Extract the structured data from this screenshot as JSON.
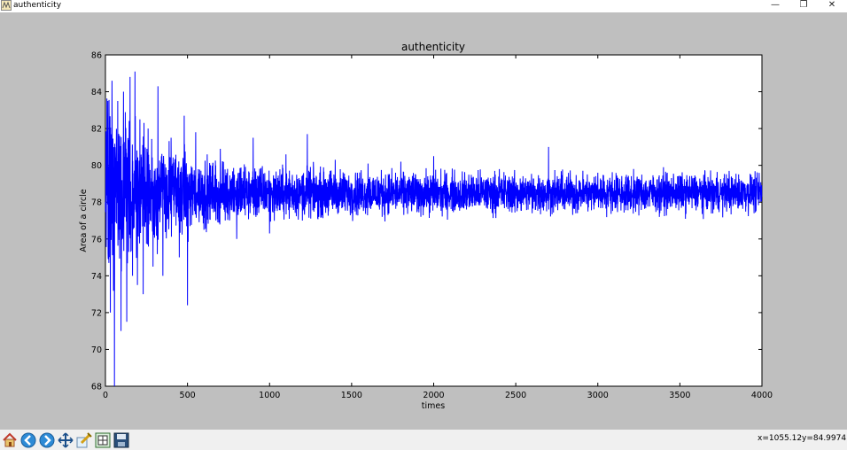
{
  "window": {
    "title": "authenticity",
    "controls": {
      "minimize": "—",
      "restore": "❐",
      "close": "✕"
    }
  },
  "chart_data": {
    "type": "line",
    "title": "authenticity",
    "xlabel": "times",
    "ylabel": "Area of a circle",
    "xlim": [
      0,
      4000
    ],
    "ylim": [
      68,
      86
    ],
    "xticks": [
      0,
      500,
      1000,
      1500,
      2000,
      2500,
      3000,
      3500,
      4000
    ],
    "yticks": [
      68,
      70,
      72,
      74,
      76,
      78,
      80,
      82,
      84,
      86
    ],
    "grid": false,
    "line_color": "#0000ff",
    "series": [
      {
        "n_points": 4000,
        "center": 78.5,
        "x": [
          0,
          15,
          30,
          40,
          55,
          75,
          95,
          110,
          130,
          150,
          165,
          180,
          195,
          210,
          230,
          260,
          290,
          320,
          350,
          400,
          450,
          480,
          500,
          550,
          600,
          700,
          800,
          900,
          1000,
          1100,
          1200,
          1230,
          1300,
          1400,
          1500,
          1600,
          1700,
          1800,
          1900,
          2000,
          2200,
          2400,
          2600,
          2700,
          2800,
          3000,
          3200,
          3400,
          3600,
          3800,
          4000
        ],
        "y": [
          78.0,
          83.5,
          72.0,
          84.6,
          68.0,
          83.5,
          71.0,
          84.0,
          71.5,
          84.8,
          74.0,
          85.1,
          73.5,
          82.5,
          73.0,
          82.0,
          74.5,
          84.3,
          74.0,
          81.5,
          75.0,
          82.7,
          72.4,
          81.8,
          76.5,
          80.9,
          76.0,
          81.5,
          76.3,
          80.6,
          77.0,
          81.7,
          77.2,
          80.3,
          77.4,
          80.1,
          77.3,
          80.2,
          77.5,
          80.5,
          77.6,
          79.8,
          77.4,
          81.0,
          77.6,
          79.6,
          77.7,
          79.9,
          77.8,
          79.7,
          78.5
        ]
      }
    ]
  },
  "status": {
    "x_readout": "x=1055.12",
    "y_readout": "y=84.9974"
  },
  "toolbar": {
    "icons": [
      "home-icon",
      "back-arrow-icon",
      "forward-arrow-icon",
      "pan-icon",
      "zoom-icon",
      "configure-subplots-icon",
      "save-icon"
    ]
  }
}
